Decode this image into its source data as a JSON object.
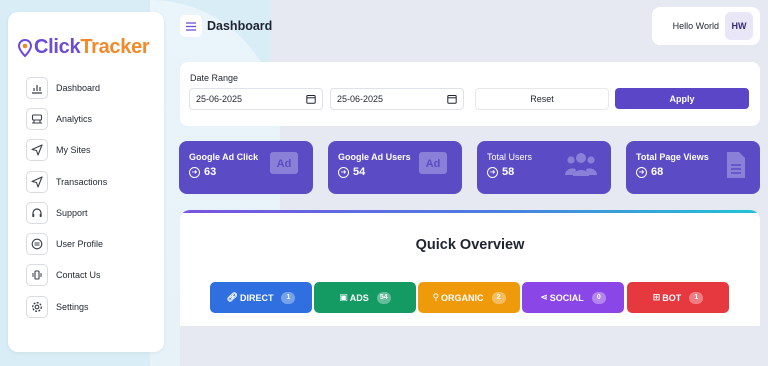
{
  "brand": {
    "part1": "Click",
    "part2": "Tracker"
  },
  "header": {
    "title": "Dashboard",
    "user_name": "Hello World",
    "avatar_initials": "HW"
  },
  "sidebar": {
    "items": [
      {
        "label": "Dashboard",
        "icon": "bar-chart-icon"
      },
      {
        "label": "Analytics",
        "icon": "analytics-icon"
      },
      {
        "label": "My Sites",
        "icon": "send-icon"
      },
      {
        "label": "Transactions",
        "icon": "send-icon"
      },
      {
        "label": "Support",
        "icon": "headphones-icon"
      },
      {
        "label": "User Profile",
        "icon": "user-circle-icon"
      },
      {
        "label": "Contact Us",
        "icon": "phone-vibrate-icon"
      },
      {
        "label": "Settings",
        "icon": "gear-icon"
      }
    ]
  },
  "filter": {
    "label": "Date Range",
    "from": "25-06-2025",
    "to": "25-06-2025",
    "reset_label": "Reset",
    "apply_label": "Apply"
  },
  "stats": [
    {
      "title": "Google Ad Click",
      "value": "63",
      "icon": "ad-icon"
    },
    {
      "title": "Google Ad Users",
      "value": "54",
      "icon": "ad-icon"
    },
    {
      "title": "Total Users",
      "value": "58",
      "icon": "users-icon"
    },
    {
      "title": "Total Page Views",
      "value": "68",
      "icon": "document-icon"
    }
  ],
  "overview": {
    "title": "Quick Overview",
    "sources": [
      {
        "label": "DIRECT",
        "count": "1",
        "icon": "link-icon",
        "color": "#2f6fe0"
      },
      {
        "label": "ADS",
        "count": "54",
        "icon": "ad-icon",
        "color": "#149a63"
      },
      {
        "label": "ORGANIC",
        "count": "2",
        "icon": "search-icon",
        "color": "#ef9a0b"
      },
      {
        "label": "SOCIAL",
        "count": "0",
        "icon": "share-icon",
        "color": "#8a46e6"
      },
      {
        "label": "BOT",
        "count": "1",
        "icon": "robot-icon",
        "color": "#e6383f"
      }
    ]
  },
  "colors": {
    "primary": "#5b46c8",
    "stat_card": "#5b4bc4",
    "brand_orange": "#f08a2a"
  }
}
